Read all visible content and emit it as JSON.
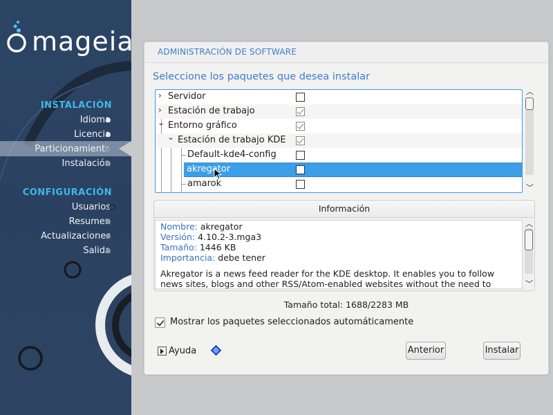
{
  "brand": {
    "name": "mageia"
  },
  "sidebar": {
    "install_header": "INSTALACIÓN",
    "install_items": [
      {
        "label": "Idioma"
      },
      {
        "label": "Licencia"
      },
      {
        "label": "Particionamiento"
      },
      {
        "label": "Instalación"
      }
    ],
    "config_header": "CONFIGURACIÓN",
    "config_items": [
      {
        "label": "Usuarios"
      },
      {
        "label": "Resumen"
      },
      {
        "label": "Actualizaciones"
      },
      {
        "label": "Salida"
      }
    ]
  },
  "panel": {
    "title": "ADMINISTRACIÓN DE SOFTWARE",
    "subtitle": "Seleccione los paquetes que desea instalar"
  },
  "tree": {
    "rows": [
      {
        "label": "Servidor",
        "expander": "›",
        "checked": false
      },
      {
        "label": "Estación de trabajo",
        "expander": "›",
        "checked": true
      },
      {
        "label": "Entorno gráfico",
        "expander": "⌄",
        "checked": true
      },
      {
        "label": "Estación de trabajo KDE",
        "expander": "⌄",
        "checked": true
      },
      {
        "label": "Default-kde4-config",
        "checked": false
      },
      {
        "label": "akregator",
        "checked": false,
        "selected": true
      },
      {
        "label": "amarok",
        "checked": false
      }
    ]
  },
  "info": {
    "header": "Información",
    "name_key": "Nombre:",
    "name_val": "akregator",
    "version_key": "Versión:",
    "version_val": "4.10.2-3.mga3",
    "size_key": "Tamaño:",
    "size_val": "1446 KB",
    "importance_key": "Importancia:",
    "importance_val": "debe tener",
    "desc_line1": "Akregator is a news feed reader for the KDE desktop. It enables you to follow",
    "desc_line2": "news sites, blogs and other RSS/Atom-enabled websites without the need to"
  },
  "total_size": "Tamaño total: 1688/2283 MB",
  "auto_selected_label": "Mostrar los paquetes seleccionados automáticamente",
  "help_label": "Ayuda",
  "buttons": {
    "back": "Anterior",
    "install": "Instalar"
  },
  "colors": {
    "accent": "#3d7bd1",
    "selection": "#3c9ee6",
    "sidebar_bg": "#2c4564",
    "sidebar_header": "#3fb6ea"
  }
}
